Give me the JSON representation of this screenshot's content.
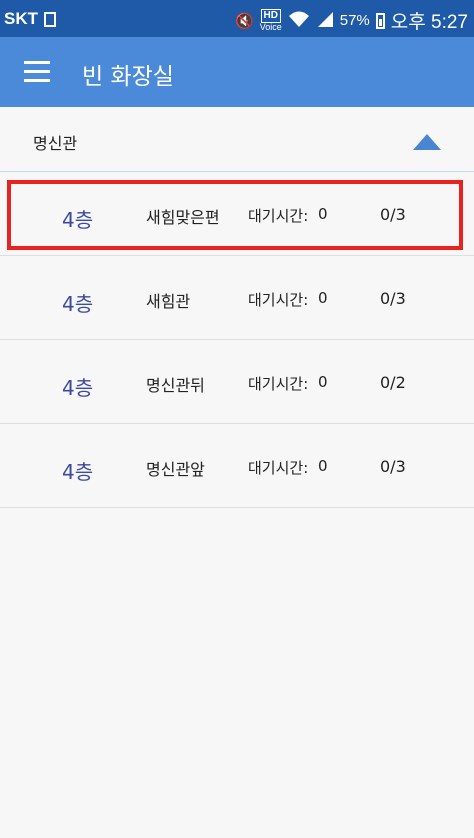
{
  "status_bar": {
    "carrier": "SKT",
    "hd_label": "HD",
    "voice_label": "Voice",
    "battery": "57%",
    "time": "오후 5:27"
  },
  "app_bar": {
    "title": "빈 화장실",
    "menu_icon": "hamburger-menu-icon"
  },
  "building": {
    "name": "명신관",
    "toggle_icon": "triangle-up-icon"
  },
  "colors": {
    "status_bar": "#1e5aa8",
    "app_bar": "#4a8ad8",
    "floor_text": "#3c4aa0",
    "highlight": "#e8231f"
  },
  "restrooms": [
    {
      "floor": "4층",
      "location": "새힘맞은편",
      "wait_label": "대기시간:",
      "wait_value": "0",
      "count": "0/3",
      "highlighted": true
    },
    {
      "floor": "4층",
      "location": "새힘관",
      "wait_label": "대기시간:",
      "wait_value": "0",
      "count": "0/3"
    },
    {
      "floor": "4층",
      "location": "명신관뒤",
      "wait_label": "대기시간:",
      "wait_value": "0",
      "count": "0/2"
    },
    {
      "floor": "4층",
      "location": "명신관앞",
      "wait_label": "대기시간:",
      "wait_value": "0",
      "count": "0/3"
    }
  ]
}
